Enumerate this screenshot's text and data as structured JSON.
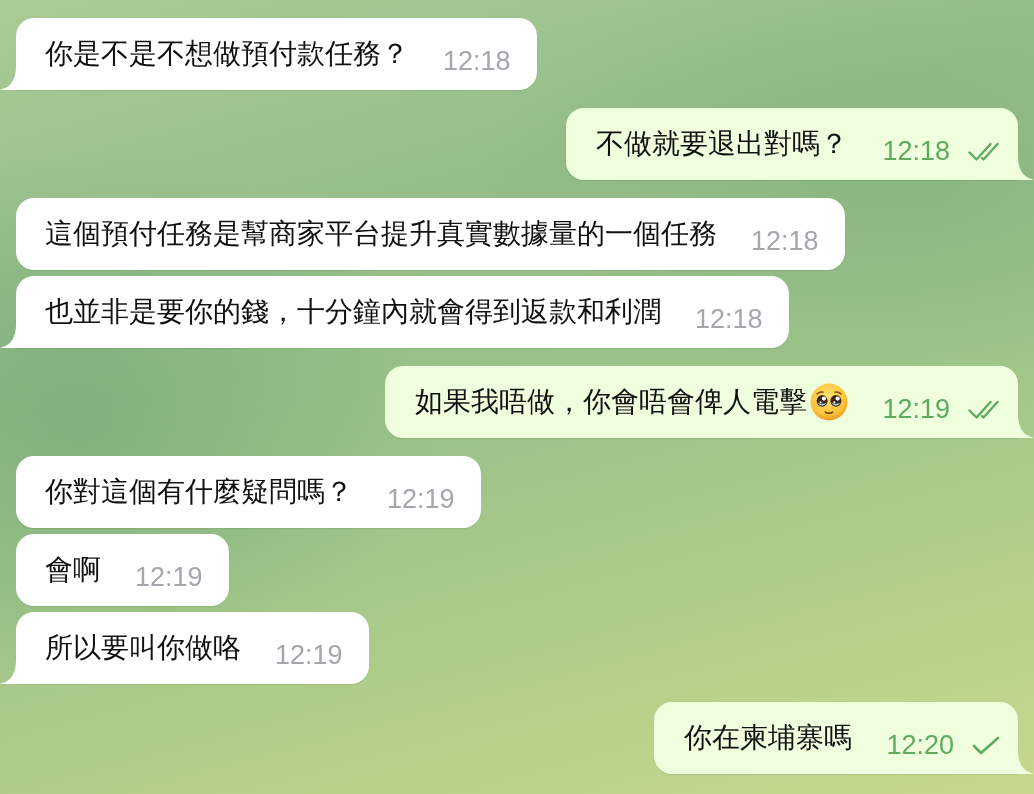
{
  "chat": {
    "messages": [
      {
        "kind": "incoming",
        "text": "你是不是不想做預付款任務？",
        "time": "12:18",
        "tail": true
      },
      {
        "kind": "outgoing",
        "text": "不做就要退出對嗎？",
        "time": "12:18",
        "tail": true,
        "read": true
      },
      {
        "kind": "incoming",
        "text": "這個預付任務是幫商家平台提升真實數據量的一個任務",
        "time": "12:18",
        "tail": false
      },
      {
        "kind": "incoming",
        "text": "也並非是要你的錢，十分鐘內就會得到返款和利潤",
        "time": "12:18",
        "tail": true
      },
      {
        "kind": "outgoing",
        "text": "如果我唔做，你會唔會俾人電擊",
        "time": "12:19",
        "tail": true,
        "emoji": true,
        "read": true
      },
      {
        "kind": "incoming",
        "text": "你對這個有什麼疑問嗎？",
        "time": "12:19",
        "tail": false
      },
      {
        "kind": "incoming",
        "text": "會啊",
        "time": "12:19",
        "tail": false
      },
      {
        "kind": "incoming",
        "text": "所以要叫你做咯",
        "time": "12:19",
        "tail": true
      },
      {
        "kind": "outgoing",
        "text": "你在柬埔寨嗎",
        "time": "12:20",
        "tail": true,
        "read": false
      }
    ]
  }
}
